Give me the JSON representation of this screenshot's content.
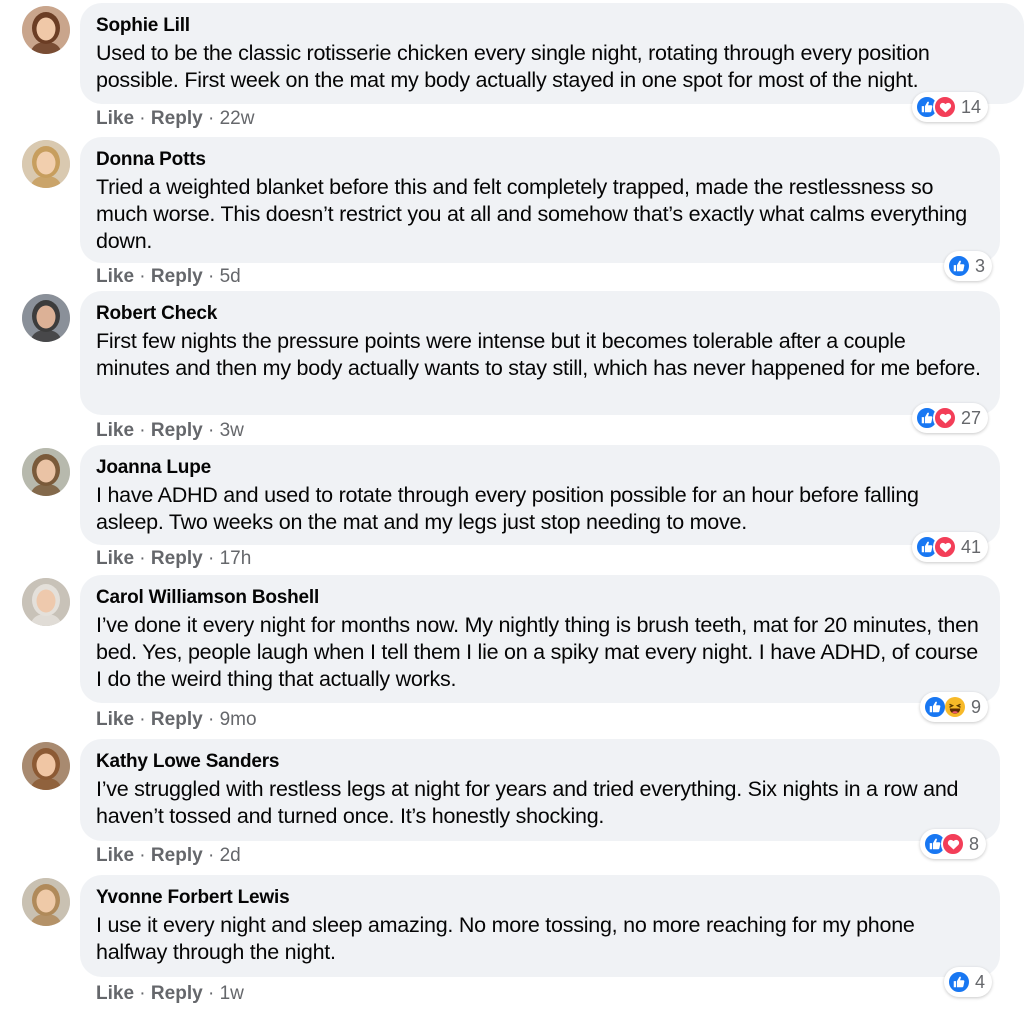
{
  "comments": [
    {
      "name": "Sophie Lill",
      "text": "Used to be the classic rotisserie chicken every single night, rotating through every position possible. First week on the mat my body actually stayed in one spot for most of the night.",
      "like_label": "Like",
      "reply_label": "Reply",
      "time": "22w",
      "reactions": [
        "like",
        "love"
      ],
      "reaction_count": "14",
      "avatar_colors": {
        "bg": "#c9a58c",
        "hair": "#6b3d24",
        "skin": "#f0c8a8"
      }
    },
    {
      "name": "Donna Potts",
      "text": "Tried a weighted blanket before this and felt completely trapped, made the restlessness so much worse. This doesn’t restrict you at all and somehow that’s exactly what calms everything down.",
      "like_label": "Like",
      "reply_label": "Reply",
      "time": "5d",
      "reactions": [
        "like"
      ],
      "reaction_count": "3",
      "avatar_colors": {
        "bg": "#d9c9b0",
        "hair": "#c79e5e",
        "skin": "#f2cfae"
      }
    },
    {
      "name": "Robert Check",
      "text": "First few nights the pressure points were intense but it becomes tolerable after a couple minutes and then my body actually wants to stay still, which has never happened for me before.",
      "like_label": "Like",
      "reply_label": "Reply",
      "time": "3w",
      "reactions": [
        "like",
        "love"
      ],
      "reaction_count": "27",
      "avatar_colors": {
        "bg": "#8a9099",
        "hair": "#3c3c3c",
        "skin": "#dcb196"
      }
    },
    {
      "name": "Joanna Lupe",
      "text": "I have ADHD and used to rotate through every position possible for an hour before falling asleep. Two weeks on the mat and my legs just stop needing to move.",
      "like_label": "Like",
      "reply_label": "Reply",
      "time": "17h",
      "reactions": [
        "like",
        "love"
      ],
      "reaction_count": "41",
      "avatar_colors": {
        "bg": "#b7b9ad",
        "hair": "#7a5a3a",
        "skin": "#eac3a5"
      }
    },
    {
      "name": "Carol Williamson Boshell",
      "text": "I’ve done it every night for months now. My nightly thing is brush teeth, mat for 20 minutes, then bed. Yes, people laugh when I tell them I lie on a spiky mat every night. I have ADHD, of course I do the weird thing that actually works.",
      "like_label": "Like",
      "reply_label": "Reply",
      "time": "9mo",
      "reactions": [
        "like",
        "haha"
      ],
      "reaction_count": "9",
      "avatar_colors": {
        "bg": "#c8c2b8",
        "hair": "#e4e0da",
        "skin": "#eec9ad"
      }
    },
    {
      "name": "Kathy Lowe Sanders",
      "text": "I’ve struggled with restless legs at night for years and tried everything. Six nights in a row and haven’t tossed and turned once. It’s honestly shocking.",
      "like_label": "Like",
      "reply_label": "Reply",
      "time": "2d",
      "reactions": [
        "like",
        "love"
      ],
      "reaction_count": "8",
      "avatar_colors": {
        "bg": "#a88a70",
        "hair": "#8c5a34",
        "skin": "#f0c6a4"
      }
    },
    {
      "name": "Yvonne Forbert Lewis",
      "text": "I use it every night and sleep amazing. No more tossing, no more reaching for my phone halfway through the night.",
      "like_label": "Like",
      "reply_label": "Reply",
      "time": "1w",
      "reactions": [
        "like"
      ],
      "reaction_count": "4",
      "avatar_colors": {
        "bg": "#c9c1b2",
        "hair": "#b08a5a",
        "skin": "#efcaa8"
      }
    }
  ],
  "colors": {
    "bubble": "#f0f2f5",
    "meta_text": "#65676b",
    "like_blue": "#1877f2",
    "love_red": "#f33e58",
    "haha_yellow": "#f7b928"
  }
}
